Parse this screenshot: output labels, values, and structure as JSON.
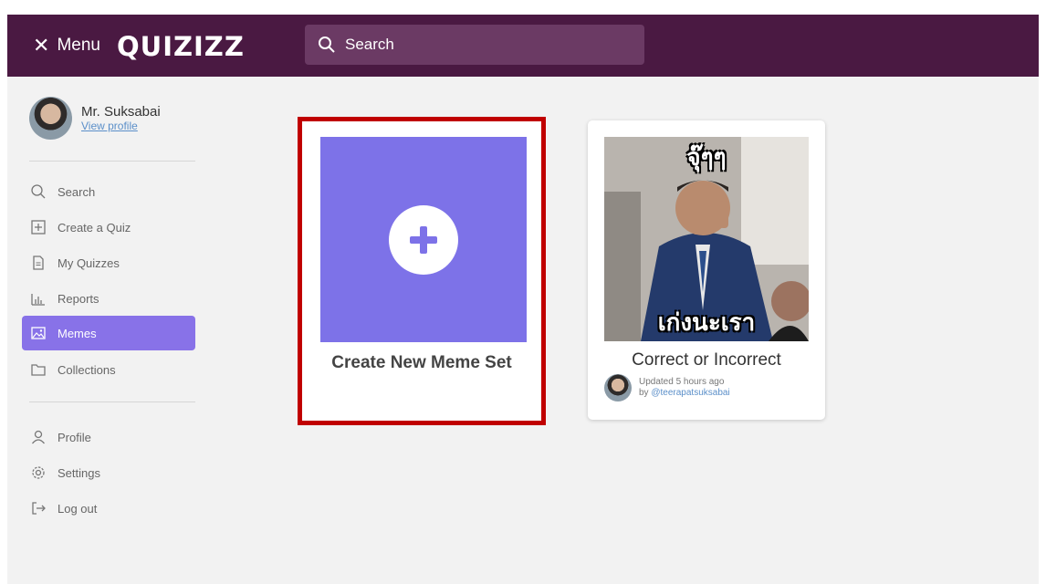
{
  "header": {
    "menu_label": "Menu",
    "close_symbol": "✕",
    "logo": "QUIZIZZ",
    "search_placeholder": "Search"
  },
  "user": {
    "name": "Mr. Suksabai",
    "view_profile": "View profile"
  },
  "nav": {
    "search": "Search",
    "create_quiz": "Create a Quiz",
    "my_quizzes": "My Quizzes",
    "reports": "Reports",
    "memes": "Memes",
    "collections": "Collections",
    "profile": "Profile",
    "settings": "Settings",
    "log_out": "Log out"
  },
  "content": {
    "create_label": "Create New Meme Set",
    "meme_set": {
      "title": "Correct or Incorrect",
      "updated": "Updated 5 hours ago",
      "by_prefix": "by",
      "author": "@teerapatsuksabai",
      "image_top_text": "จุ๊ๆๆ",
      "image_bottom_text": "เก่งนะเรา"
    }
  },
  "colors": {
    "header_bg": "#4a1942",
    "accent": "#8872e8",
    "create_tile": "#7d72e8",
    "highlight_border": "#c00000"
  }
}
